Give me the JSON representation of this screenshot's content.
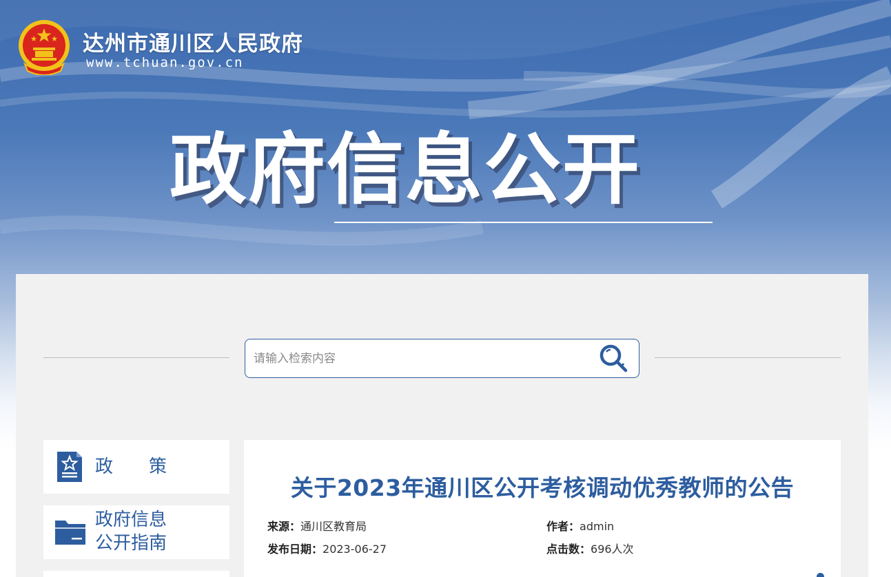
{
  "header": {
    "site_name": "达州市通川区人民政府",
    "site_url": "www.tchuan.gov.cn",
    "emblem_icon": "national-emblem-icon",
    "banner_title": "政府信息公开"
  },
  "search": {
    "placeholder": "请输入检索内容",
    "button_icon": "search-icon"
  },
  "sidebar": {
    "items": [
      {
        "label": "政　　策",
        "icon": "policy-document-icon"
      },
      {
        "label_line1": "政府信息",
        "label_line2": "公开指南",
        "icon": "folder-icon"
      }
    ]
  },
  "article": {
    "title": "关于2023年通川区公开考核调动优秀教师的公告",
    "source_label": "来源：",
    "source_value": "通川区教育局",
    "author_label": "作者：",
    "author_value": "admin",
    "date_label": "发布日期：",
    "date_value": "2023-06-27",
    "clicks_label": "点击数：",
    "clicks_value": "696人次"
  },
  "colors": {
    "accent": "#2d5d9f",
    "banner_blue": "#3d6bb0",
    "panel_bg": "#f1f1f1",
    "emblem_gold": "#f2c21b",
    "emblem_red": "#d9251d"
  }
}
